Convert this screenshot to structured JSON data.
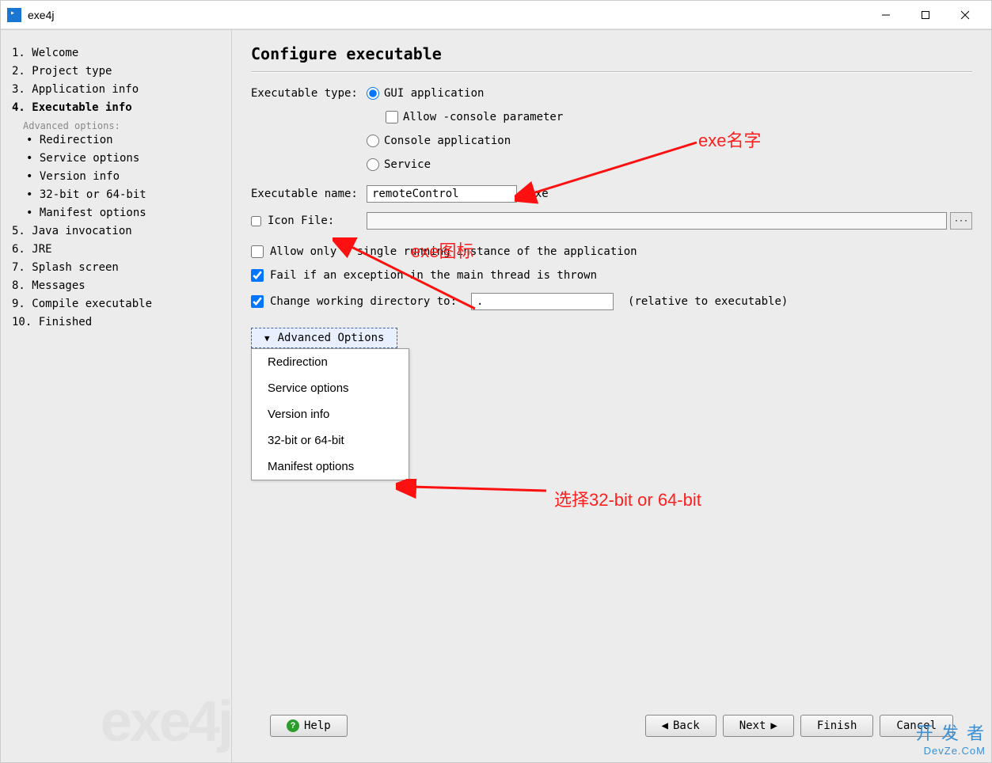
{
  "window": {
    "title": "exe4j"
  },
  "sidebar": {
    "steps": [
      "1. Welcome",
      "2. Project type",
      "3. Application info",
      "4. Executable info",
      "5. Java invocation",
      "6. JRE",
      "7. Splash screen",
      "8. Messages",
      "9. Compile executable",
      "10. Finished"
    ],
    "active_index": 3,
    "advanced_label": "Advanced options:",
    "sub_steps": [
      "Redirection",
      "Service options",
      "Version info",
      "32-bit or 64-bit",
      "Manifest options"
    ],
    "watermark": "exe4j"
  },
  "main": {
    "heading": "Configure executable",
    "exec_type_label": "Executable type:",
    "radio_gui": "GUI application",
    "allow_console": "Allow -console parameter",
    "radio_console": "Console application",
    "radio_service": "Service",
    "exec_name_label": "Executable name:",
    "exec_name_value": "remoteControl",
    "exec_name_suffix": ".exe",
    "icon_file_label": "Icon File:",
    "icon_file_value": "",
    "browse_label": "···",
    "allow_single_label": "Allow only a single running instance of the application",
    "fail_exception_label": "Fail if an exception in the main thread is thrown",
    "change_dir_label": "Change working directory to:",
    "change_dir_value": ".",
    "relative_label": "(relative to executable)",
    "adv_button": "Advanced Options",
    "adv_menu": [
      "Redirection",
      "Service options",
      "Version info",
      "32-bit or 64-bit",
      "Manifest options"
    ]
  },
  "footer": {
    "help": "Help",
    "back": "Back",
    "next": "Next",
    "finish": "Finish",
    "cancel": "Cancel"
  },
  "annotations": {
    "exe_name": "exe名字",
    "exe_icon": "exe图标",
    "select_bit": "选择32-bit or 64-bit"
  },
  "watermark2": {
    "line1": "开 发 者",
    "line2": "DevZe.CoM"
  }
}
